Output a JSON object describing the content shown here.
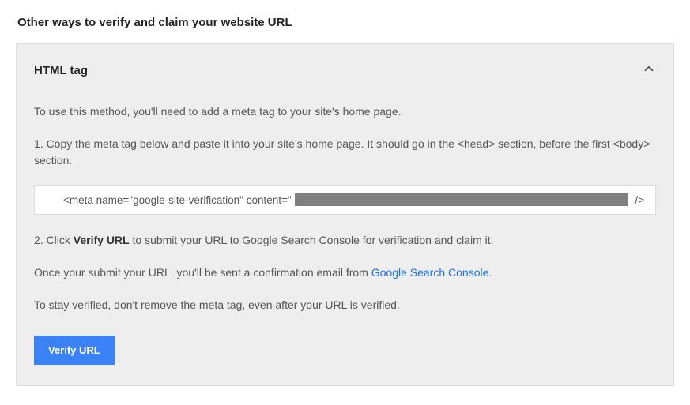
{
  "page": {
    "title": "Other ways to verify and claim your website URL"
  },
  "panel": {
    "header": "HTML tag",
    "intro": "To use this method, you'll need to add a meta tag to your site's home page.",
    "step1": "1. Copy the meta tag below and paste it into your site's home page. It should go in the <head> section, before the first <body> section.",
    "code_prefix": "<meta name=\"google-site-verification\" content=\"",
    "code_suffix": " />",
    "step2_prefix": "2. Click ",
    "step2_bold": "Verify URL",
    "step2_suffix": " to submit your URL to Google Search Console for verification and claim it.",
    "confirm_prefix": "Once your submit your URL, you'll be sent a confirmation email from ",
    "confirm_link": "Google Search Console",
    "confirm_suffix": ".",
    "stay_note": "To stay verified, don't remove the meta tag, even after your URL is verified.",
    "button_label": "Verify URL"
  }
}
